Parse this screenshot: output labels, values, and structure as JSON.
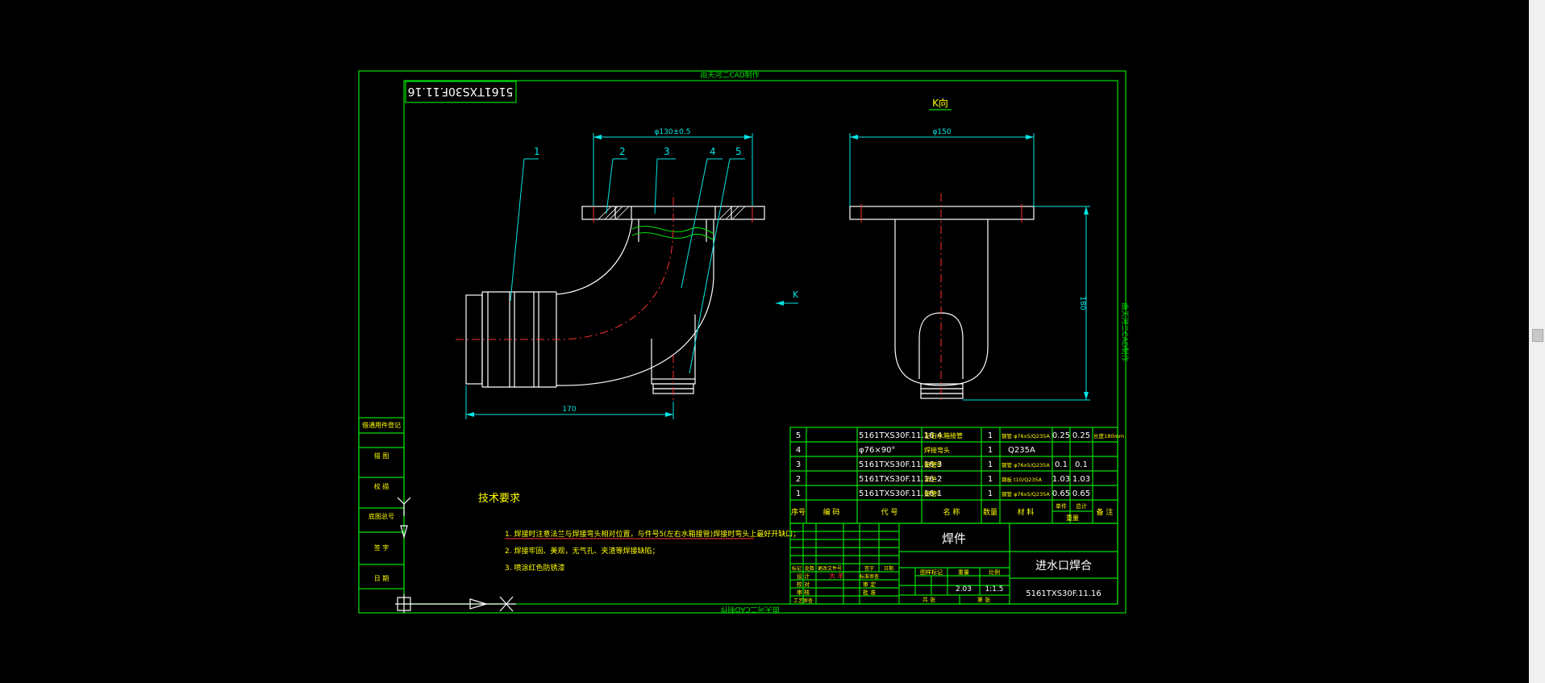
{
  "drawing": {
    "frame_side_label": "由天河二CAD制作",
    "title_box_rotated": "5161TXS30F.11.16",
    "k_view_label": "K向",
    "k_arrow_label": "K",
    "dim_flange_left": "φ130±0.5",
    "dim_flange_right": "φ150",
    "dim_width_bottom": "170",
    "dim_height_right": "180",
    "balloons": [
      "1",
      "2",
      "3",
      "4",
      "5"
    ]
  },
  "left_strip": {
    "cells": [
      "借通用件登记",
      "描  图",
      "校  描",
      "底图总号",
      "签  字",
      "日  期"
    ]
  },
  "tech_requirements": {
    "title": "技术要求",
    "items": [
      "1. 焊接时注意法兰与焊接弯头相对位置，与件号5(左右水箱接管)焊接时弯头上最好开缺口；",
      "2. 焊接牢固、美观，无气孔、夹渣等焊接缺陷；",
      "3. 喷涂红色防锈漆"
    ]
  },
  "bom": {
    "headers": [
      "序号",
      "编    码",
      "代    号",
      "名    称",
      "数量",
      "材    料",
      "单件",
      "总计",
      "重量",
      "备  注"
    ],
    "rows": [
      {
        "no": "5",
        "code": "",
        "ref": "5161TXS30F.11.16-4",
        "name": "左右水箱接管",
        "qty": "1",
        "material": "钢管 φ76x5/Q235A",
        "unit": "0.25",
        "total": "0.25",
        "note": "长度180mm"
      },
      {
        "no": "4",
        "code": "",
        "ref": "φ76×90°",
        "name": "焊接弯头",
        "qty": "1",
        "material": "Q235A",
        "unit": "",
        "total": "",
        "note": ""
      },
      {
        "no": "3",
        "code": "",
        "ref": "5161TXS30F.11.16-3",
        "name": "接管II",
        "qty": "1",
        "material": "钢管 φ76x5/Q235A",
        "unit": "0.1",
        "total": "0.1",
        "note": ""
      },
      {
        "no": "2",
        "code": "",
        "ref": "5161TXS30F.11.16-2",
        "name": "法兰",
        "qty": "1",
        "material": "钢板 t10/Q235A",
        "unit": "1.03",
        "total": "1.03",
        "note": ""
      },
      {
        "no": "1",
        "code": "",
        "ref": "5161TXS30F.11.16-1",
        "name": "接管I",
        "qty": "1",
        "material": "钢管 φ76x5/Q235A",
        "unit": "0.65",
        "total": "0.65",
        "note": ""
      }
    ]
  },
  "title_block": {
    "type_label": "焊件",
    "part_name": "进水口焊合",
    "drawing_number": "5161TXS30F.11.16",
    "stage_label": "图样标记",
    "weight_label": "重量",
    "scale_label": "比例",
    "weight": "2.03",
    "scale": "1:1.5",
    "sheet_label": "共    张",
    "sheet_of_label": "第    张",
    "sign_labels": [
      "标记",
      "处数",
      "更改文件号",
      "签字",
      "日期"
    ],
    "roles": [
      "设 计",
      "校 对",
      "审 核",
      "工艺审查"
    ],
    "role_tags": [
      "标准审查",
      "审 定",
      "批 准"
    ]
  },
  "colors": {
    "background": "#000000",
    "frame": "#00e000",
    "object": "#ffffff",
    "dimension": "#00e6e6",
    "centerline": "#ff3030",
    "text_yellow": "#ffff00"
  }
}
